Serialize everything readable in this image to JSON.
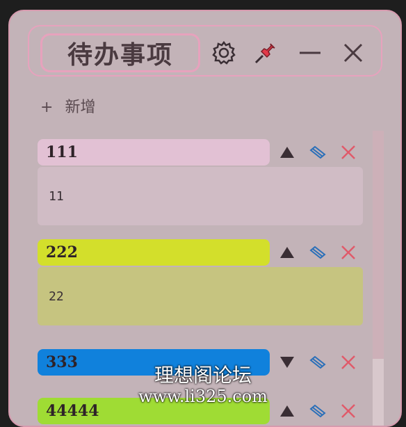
{
  "header": {
    "title": "待办事项",
    "icons": [
      "gear-icon",
      "pin-icon",
      "minimize-icon",
      "close-icon"
    ]
  },
  "add": {
    "plus": "+",
    "label": "新增"
  },
  "todos": [
    {
      "title": "111",
      "content": "11",
      "title_color": "#e2c1d4",
      "body_color": "#d0bcc5",
      "order_icon": "up-arrow-icon"
    },
    {
      "title": "222",
      "content": "22",
      "title_color": "#d3df2b",
      "body_color": "#c6c480",
      "order_icon": "up-arrow-icon"
    },
    {
      "title": "333",
      "content": "",
      "title_color": "#1081dc",
      "body_color": "",
      "order_icon": "down-arrow-icon"
    },
    {
      "title": "44444",
      "content": "",
      "title_color": "#9fdc34",
      "body_color": "",
      "order_icon": "up-arrow-icon"
    }
  ],
  "watermark": {
    "line1": "理想阁论坛",
    "line2": "www.li325.com"
  }
}
